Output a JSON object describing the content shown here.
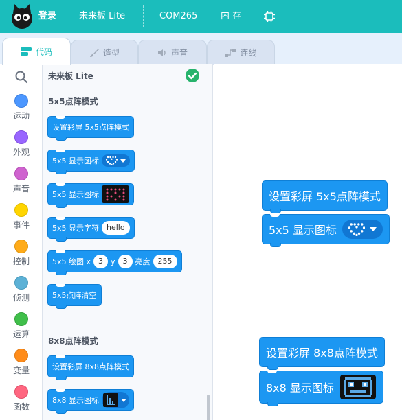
{
  "topbar": {
    "login": "登录",
    "device": "未来板 Lite",
    "port": "COM265",
    "memory": "内 存"
  },
  "tabs": [
    {
      "label": "代码",
      "icon": "code-icon",
      "active": true
    },
    {
      "label": "造型",
      "icon": "brush-icon",
      "active": false
    },
    {
      "label": "声音",
      "icon": "speaker-icon",
      "active": false
    },
    {
      "label": "连线",
      "icon": "wiring-icon",
      "active": false
    }
  ],
  "categories": [
    {
      "label": "运动",
      "color": "#4c97ff"
    },
    {
      "label": "外观",
      "color": "#9966ff"
    },
    {
      "label": "声音",
      "color": "#cf63cf"
    },
    {
      "label": "事件",
      "color": "#ffd500"
    },
    {
      "label": "控制",
      "color": "#ffab19"
    },
    {
      "label": "侦测",
      "color": "#5cb1d6"
    },
    {
      "label": "运算",
      "color": "#40bf4a"
    },
    {
      "label": "变量",
      "color": "#ff8c1a"
    },
    {
      "label": "函数",
      "color": "#ff6680"
    }
  ],
  "palette": {
    "device_title": "未来板 Lite",
    "section_5x5": "5x5点阵模式",
    "section_8x8": "8x8点阵模式",
    "blocks": {
      "set_5x5": "设置彩屏 5x5点阵模式",
      "show_icon_5x5": "5x5 显示图标",
      "show_char_5x5": "5x5 显示字符",
      "char_value": "hello",
      "draw_5x5": "5x5 绘图 x",
      "draw_x": "3",
      "y_label": "y",
      "draw_y": "3",
      "brightness_label": "亮度",
      "brightness": "255",
      "clear_5x5": "5x5点阵清空",
      "set_8x8": "设置彩屏 8x8点阵模式",
      "show_icon_8x8": "8x8 显示图标"
    }
  },
  "workspace": {
    "set_5x5": "设置彩屏 5x5点阵模式",
    "show_icon_5x5": "5x5 显示图标",
    "set_8x8": "设置彩屏 8x8点阵模式",
    "show_icon_8x8": "8x8 显示图标"
  },
  "colors": {
    "topbar": "#1bbdbc",
    "block": "#1c97f2",
    "tab_bar": "#e6f0fc"
  }
}
